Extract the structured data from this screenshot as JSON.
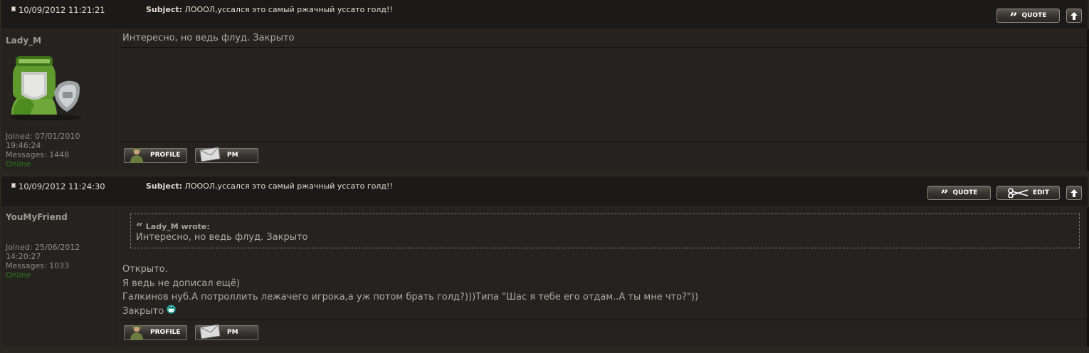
{
  "posts": [
    {
      "date": "10/09/2012 11:21:21",
      "subject_label": "Subject:",
      "subject": "ЛОООЛ,уссался это самый ржачный уссато голд!!",
      "quote_label": "QUOTE",
      "author": "Lady_M",
      "joined": "Joined: 07/01/2010",
      "joined_time": "19:46:24",
      "messages": "Messages: 1448",
      "status": "Online",
      "body": [
        "Интересно, но ведь флуд. Закрыто"
      ],
      "profile_label": "PROFILE",
      "pm_label": "PM"
    },
    {
      "date": "10/09/2012 11:24:30",
      "subject_label": "Subject:",
      "subject": "ЛОООЛ,уссался это самый ржачный уссато голд!!",
      "quote_label": "QUOTE",
      "edit_label": "EDIT",
      "author": "YouMyFriend",
      "joined": "Joined: 25/06/2012",
      "joined_time": "14:20:27",
      "messages": "Messages: 1033",
      "status": "Online",
      "quote": {
        "author": "Lady_M wrote:",
        "text": "Интересно, но ведь флуд. Закрыто"
      },
      "body": [
        "Открыто.",
        "Я ведь не дописал ещё)",
        "Галкинов нуб.А потроллить лежачего игрока,а уж потом брать голд?)))Типа \"Шас я тебе его отдам..А ты мне что?\"))",
        "Закрыто"
      ],
      "profile_label": "PROFILE",
      "pm_label": "PM"
    }
  ],
  "icons": {
    "post": "post-icon",
    "quote": "quote-marks-icon",
    "edit": "scissors-icon",
    "top": "arrow-up-icon",
    "avatar": "tank-helmet-avatar",
    "profile": "soldier-icon",
    "pm": "envelope-icon",
    "smiley": "grin-smiley-icon"
  },
  "colors": {
    "background": "#2a2622",
    "header": "#1c1a18",
    "online": "#2f7a1c"
  }
}
